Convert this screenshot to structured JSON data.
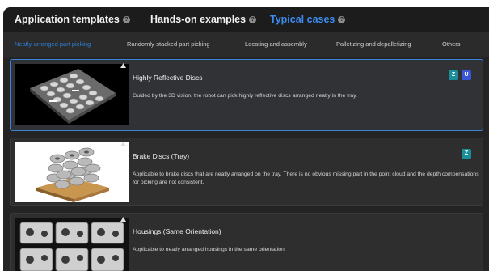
{
  "tabs": [
    {
      "label": "Application templates",
      "active": false
    },
    {
      "label": "Hands-on examples",
      "active": false
    },
    {
      "label": "Typical cases",
      "active": true
    }
  ],
  "subtabs": [
    {
      "label": "Neatly-arranged part picking",
      "active": true
    },
    {
      "label": "Randomly-stacked part picking",
      "active": false
    },
    {
      "label": "Locating and assembly",
      "active": false
    },
    {
      "label": "Palletizing and depalletizing",
      "active": false
    },
    {
      "label": "Others",
      "active": false
    }
  ],
  "cards": [
    {
      "title": "Highly Reflective Discs",
      "description": "Guided by the 3D vision, the robot can pick highly reflective discs arranged neatly in the tray.",
      "badges": [
        "teal-badge-icon",
        "blue-badge-icon"
      ],
      "selected": true
    },
    {
      "title": "Brake Discs (Tray)",
      "description": "Applicable to brake discs that are neatly arranged on the tray. There is no obvious missing part in the point cloud and the depth compensations for picking are not consistent.",
      "badges": [
        "teal-badge-icon"
      ],
      "selected": false
    },
    {
      "title": "Housings (Same Orientation)",
      "description": "Applicable to neatly arranged housings in the same orientation.",
      "badges": [],
      "selected": false
    }
  ],
  "colors": {
    "accent": "#3c8cf0",
    "background": "#242424",
    "selected_border": "#3c82d8",
    "badge_teal": "#1a8f9a",
    "badge_blue": "#3a56d8"
  }
}
